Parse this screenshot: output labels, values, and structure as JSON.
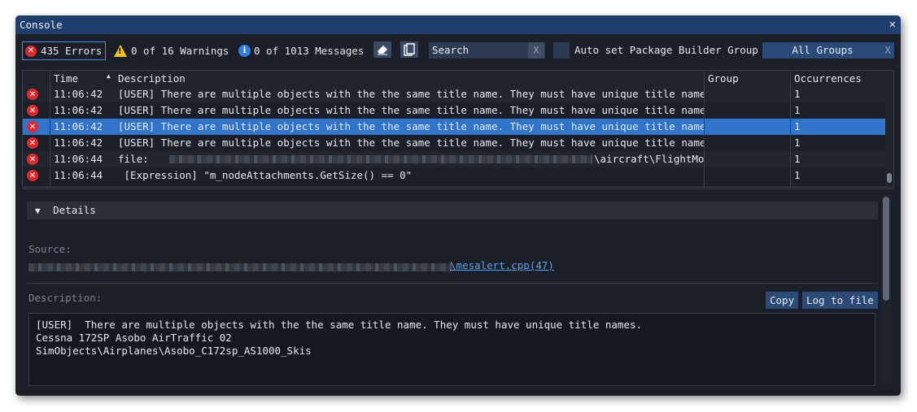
{
  "window": {
    "title": "Console",
    "close_glyph": "✕"
  },
  "toolbar": {
    "errors_label": "435 Errors",
    "warnings_label": "0 of 16 Warnings",
    "messages_label": "0 of 1013 Messages",
    "search_placeholder": "Search",
    "search_clear": "X",
    "auto_set_label": "Auto set Package Builder Group",
    "group_select": "All Groups",
    "group_clear": "X"
  },
  "table": {
    "headers": {
      "time": "Time",
      "description": "Description",
      "group": "Group",
      "occurrences": "Occurrences"
    },
    "rows": [
      {
        "time": "11:06:42",
        "description": "[USER]  There are multiple objects with the the same title name. They must have unique title names.",
        "group": "",
        "occurrences": "1"
      },
      {
        "time": "11:06:42",
        "description": "[USER]  There are multiple objects with the the same title name. They must have unique title names.",
        "group": "",
        "occurrences": "1"
      },
      {
        "time": "11:06:42",
        "description": "[USER]  There are multiple objects with the the same title name. They must have unique title names.",
        "group": "",
        "occurrences": "1"
      },
      {
        "time": "11:06:42",
        "description": "[USER]  There are multiple objects with the the same title name. They must have unique title names.",
        "group": "",
        "occurrences": "1"
      },
      {
        "time": "11:06:44",
        "description": "file:",
        "description_tail": "\\aircraft\\FlightMod",
        "group": "",
        "occurrences": "1"
      },
      {
        "time": "11:06:44",
        "description": " [Expression] \"m_nodeAttachments.GetSize() == 0\"",
        "group": "",
        "occurrences": "1"
      }
    ]
  },
  "details": {
    "header": "Details",
    "source_label": "Source:",
    "source_file": "\\mesalert.cpp(47)",
    "description_label": "Description:",
    "copy_label": "Copy",
    "log_label": "Log to file",
    "description_lines": [
      "[USER]  There are multiple objects with the the same title name. They must have unique title names.",
      "",
      "Cessna 172SP Asobo AirTraffic 02",
      "SimObjects\\Airplanes\\Asobo_C172sp_AS1000_Skis"
    ]
  },
  "colors": {
    "accent": "#2f74c8",
    "error": "#e0282e",
    "warning": "#f2c21b",
    "info": "#2f7fe0",
    "titlebar": "#1f3e6b"
  }
}
